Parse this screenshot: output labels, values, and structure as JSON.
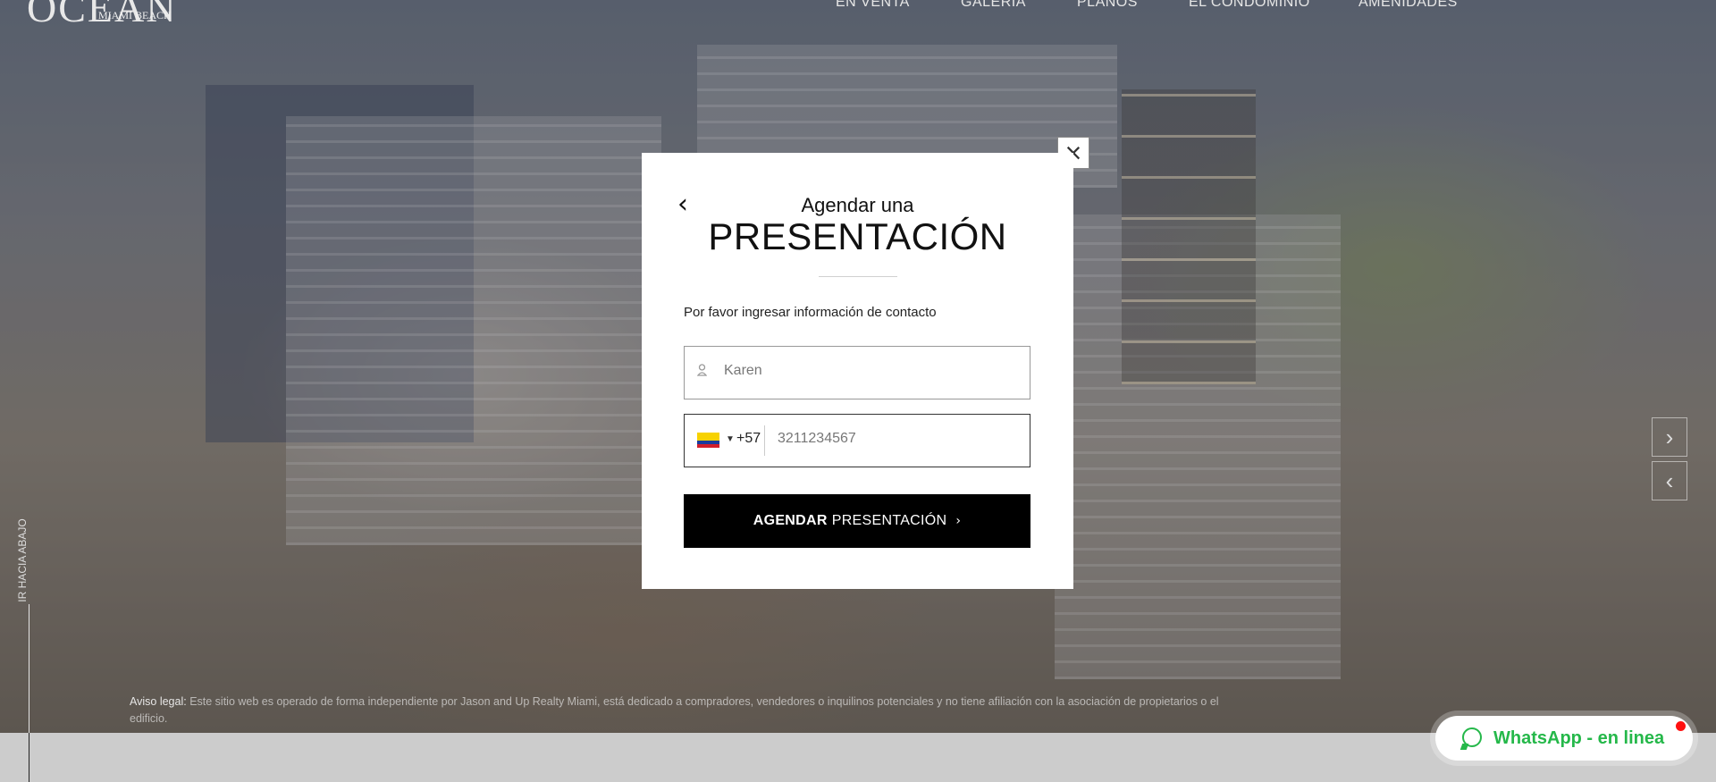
{
  "header": {
    "logo_mark": "OCEAN",
    "logo_sub": "MIAMI BEACH",
    "nav": [
      "EN VENTA",
      "GALERÍA",
      "PLANOS",
      "EL CONDOMINIO",
      "AMENIDADES"
    ]
  },
  "side": {
    "scroll_label": "IR HACIA ABAJO"
  },
  "slider": {
    "next_icon": "chevron-right-icon",
    "prev_icon": "chevron-left-icon"
  },
  "disclaimer": {
    "label": "Aviso legal:",
    "text": "Este sitio web es operado de forma independiente por Jason and Up Realty Miami, está dedicado a compradores, vendedores o inquilinos potenciales y no tiene afiliación con la asociación de propietarios o el edificio."
  },
  "whatsapp": {
    "label": "WhatsApp - en linea",
    "color": "#25b84a"
  },
  "modal": {
    "title_small": "Agendar una",
    "title_large": "PRESENTACIÓN",
    "instruction": "Por favor ingresar información de contacto",
    "name_field": {
      "value": "Karen",
      "icon": "user-icon"
    },
    "phone_field": {
      "country": "Colombia",
      "dial_code": "+57",
      "value": "3211234567"
    },
    "submit": {
      "bold": "AGENDAR",
      "rest": "PRESENTACIÓN"
    }
  }
}
